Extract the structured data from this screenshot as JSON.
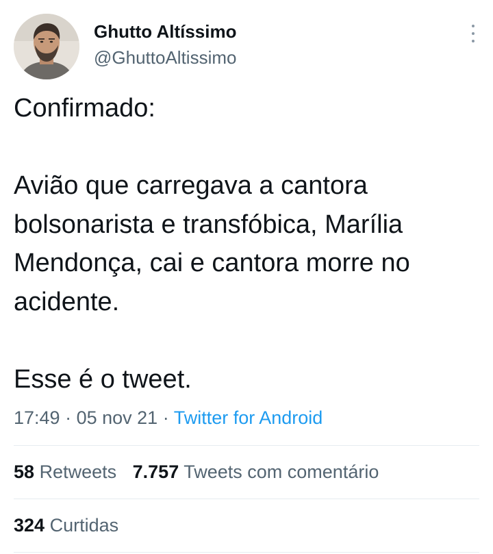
{
  "author": {
    "display_name": "Ghutto Altíssimo",
    "handle": "@GhuttoAltissimo",
    "avatar_icon": "profile-photo"
  },
  "tweet": {
    "line1": "Confirmado:",
    "paragraph2": "Avião que carregava a cantora bolsonarista e transfóbica, Marília Mendonça, cai e cantora morre no acidente.",
    "line3": "Esse é o tweet."
  },
  "meta": {
    "time": "17:49",
    "sep1": " · ",
    "date": "05 nov 21",
    "sep2": " · ",
    "source": "Twitter for Android"
  },
  "stats": {
    "retweets_count": "58",
    "retweets_label": "Retweets",
    "quotes_count": "7.757",
    "quotes_label": "Tweets com comentário",
    "likes_count": "324",
    "likes_label": "Curtidas"
  },
  "colors": {
    "text": "#0f1419",
    "secondary": "#536471",
    "link": "#1d9bf0",
    "divider": "#e6ecf0"
  }
}
